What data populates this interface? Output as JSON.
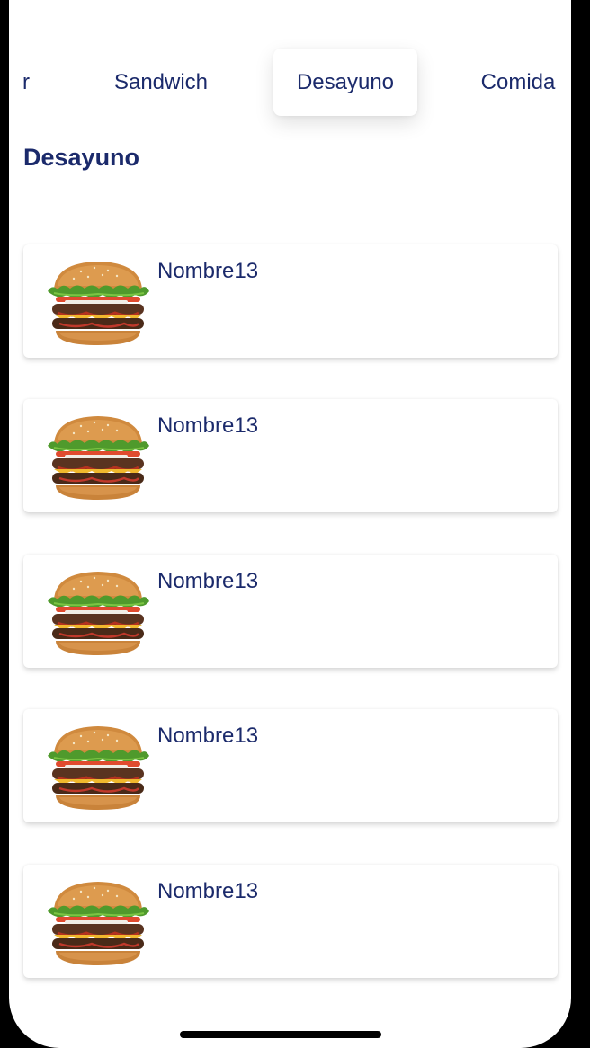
{
  "tabs": [
    {
      "label": "r",
      "active": false
    },
    {
      "label": "Sandwich",
      "active": false
    },
    {
      "label": "Desayuno",
      "active": true
    },
    {
      "label": "Comida",
      "active": false
    }
  ],
  "section": {
    "title": "Desayuno"
  },
  "items": [
    {
      "name": "Nombre13",
      "image_icon": "burger-image"
    },
    {
      "name": "Nombre13",
      "image_icon": "burger-image"
    },
    {
      "name": "Nombre13",
      "image_icon": "burger-image"
    },
    {
      "name": "Nombre13",
      "image_icon": "burger-image"
    },
    {
      "name": "Nombre13",
      "image_icon": "burger-image"
    }
  ],
  "colors": {
    "text": "#1b2a6b",
    "background": "#ffffff",
    "frame": "#000000"
  }
}
